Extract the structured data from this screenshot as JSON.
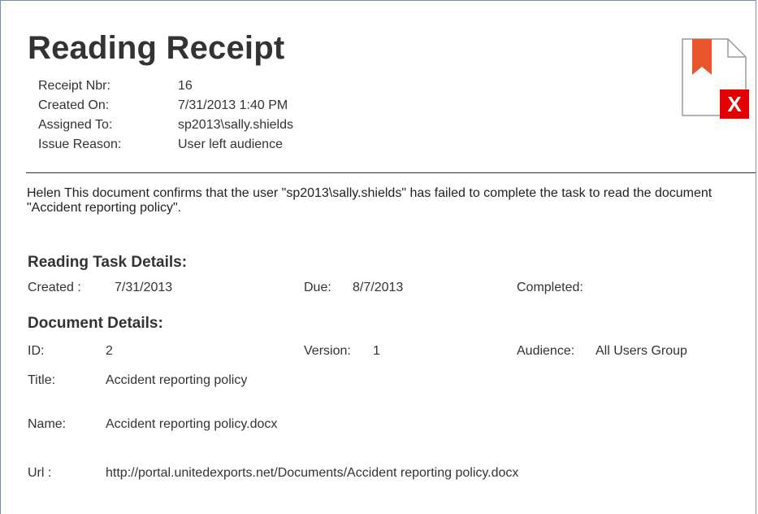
{
  "receipt": {
    "title": "Reading Receipt",
    "meta": [
      {
        "label": "Receipt Nbr:",
        "value": "16"
      },
      {
        "label": "Created On:",
        "value": "7/31/2013 1:40 PM"
      },
      {
        "label": "Assigned To:",
        "value": "sp2013\\sally.shields"
      },
      {
        "label": "Issue Reason:",
        "value": "User left audience"
      }
    ],
    "icon": {
      "name": "document-failed-icon",
      "badge": "X",
      "bookmark_color": "#e8552f",
      "badge_color": "#e40000"
    }
  },
  "message": "Helen This document confirms that the user \"sp2013\\sally.shields\" has failed to complete the task to read the document \"Accident reporting policy\".",
  "task": {
    "section_title": "Reading Task Details:",
    "created_label": "Created :",
    "created_value": "7/31/2013",
    "due_label": "Due:",
    "due_value": "8/7/2013",
    "completed_label": "Completed:",
    "completed_value": ""
  },
  "document": {
    "section_title": "Document Details:",
    "id_label": "ID:",
    "id_value": "2",
    "version_label": "Version:",
    "version_value": "1",
    "audience_label": "Audience:",
    "audience_value": "All Users Group",
    "title_label": "Title:",
    "title_value": "Accident reporting policy",
    "name_label": "Name:",
    "name_value": "Accident reporting policy.docx",
    "url_label": "Url :",
    "url_value": "http://portal.unitedexports.net/Documents/Accident reporting policy.docx"
  }
}
